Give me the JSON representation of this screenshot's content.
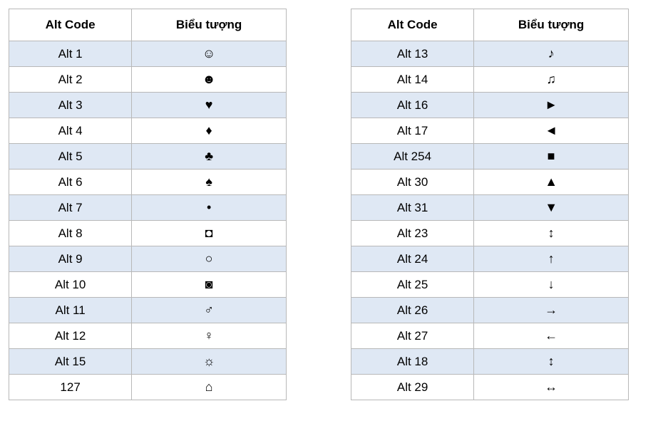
{
  "headers": {
    "alt_code": "Alt Code",
    "symbol": "Biểu tượng"
  },
  "left_table": [
    {
      "code": "Alt 1",
      "symbol": "☺"
    },
    {
      "code": "Alt 2",
      "symbol": "☻"
    },
    {
      "code": "Alt 3",
      "symbol": "♥"
    },
    {
      "code": "Alt 4",
      "symbol": "♦"
    },
    {
      "code": "Alt 5",
      "symbol": "♣"
    },
    {
      "code": "Alt 6",
      "symbol": "♠"
    },
    {
      "code": "Alt 7",
      "symbol": "•"
    },
    {
      "code": "Alt 8",
      "symbol": "◘"
    },
    {
      "code": "Alt 9",
      "symbol": "○"
    },
    {
      "code": "Alt 10",
      "symbol": "◙"
    },
    {
      "code": "Alt 11",
      "symbol": "♂"
    },
    {
      "code": "Alt 12",
      "symbol": "♀"
    },
    {
      "code": "Alt 15",
      "symbol": "☼"
    },
    {
      "code": "127",
      "symbol": "⌂"
    }
  ],
  "right_table": [
    {
      "code": "Alt 13",
      "symbol": "♪"
    },
    {
      "code": "Alt 14",
      "symbol": "♫"
    },
    {
      "code": "Alt 16",
      "symbol": "►"
    },
    {
      "code": "Alt 17",
      "symbol": "◄"
    },
    {
      "code": "Alt 254",
      "symbol": "■"
    },
    {
      "code": "Alt 30",
      "symbol": "▲"
    },
    {
      "code": "Alt 31",
      "symbol": "▼"
    },
    {
      "code": "Alt 23",
      "symbol": "↕"
    },
    {
      "code": "Alt 24",
      "symbol": "↑"
    },
    {
      "code": "Alt 25",
      "symbol": "↓"
    },
    {
      "code": "Alt 26",
      "symbol": "→"
    },
    {
      "code": "Alt 27",
      "symbol": "←"
    },
    {
      "code": "Alt 18",
      "symbol": "↕"
    },
    {
      "code": "Alt 29",
      "symbol": "↔"
    }
  ]
}
